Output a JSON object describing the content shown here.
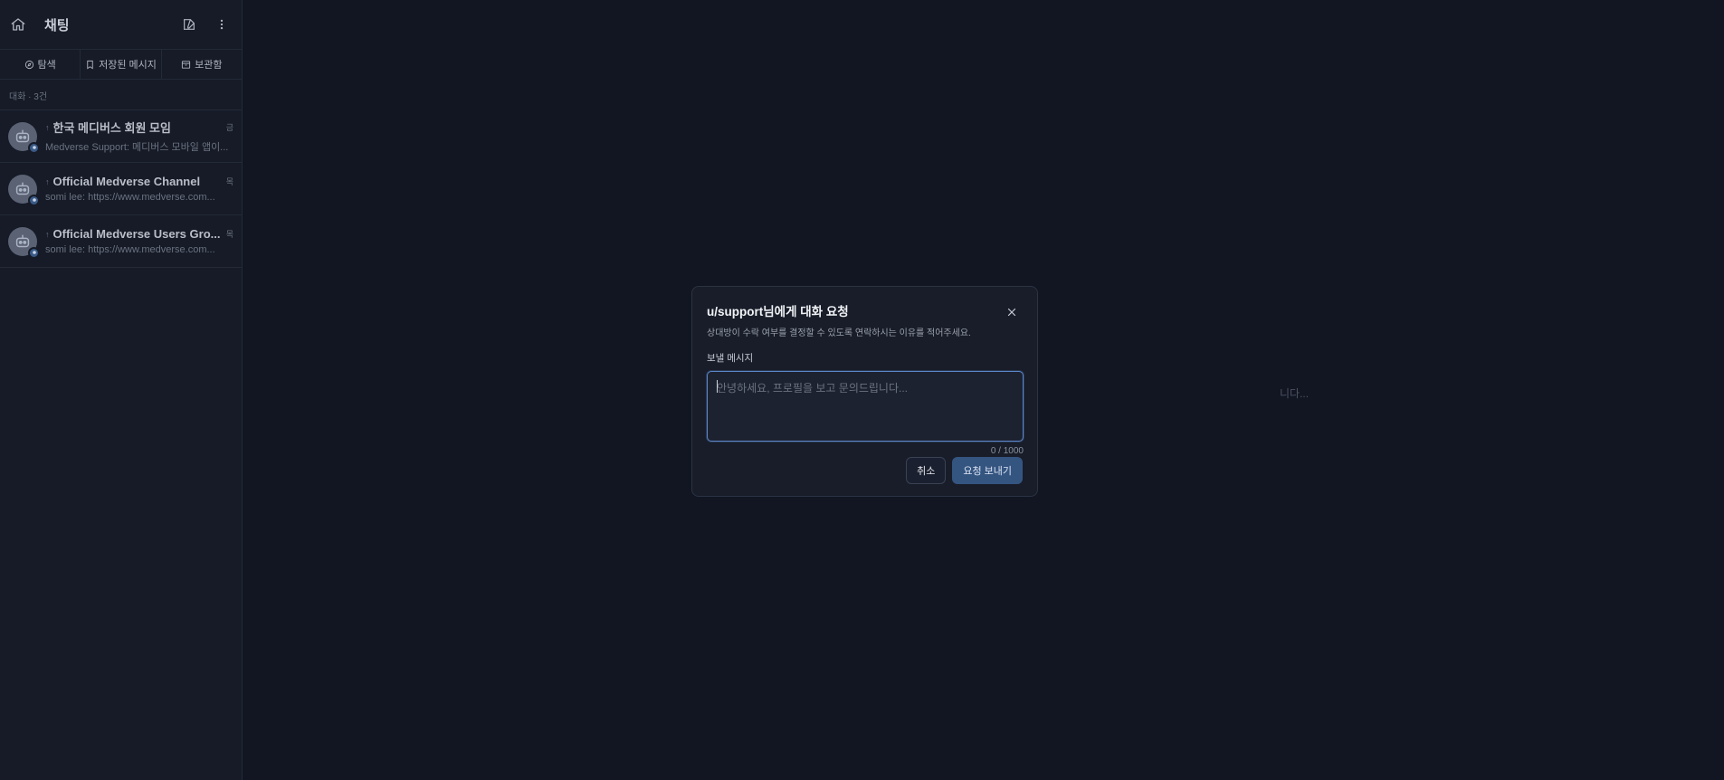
{
  "sidebar": {
    "title": "채팅",
    "tabs": [
      {
        "label": "탐색"
      },
      {
        "label": "저장된 메시지"
      },
      {
        "label": "보관함"
      }
    ],
    "count_label": "대화 · 3건",
    "conversations": [
      {
        "name": "한국 메디버스 회원 모임",
        "time": "금",
        "preview": "Medverse Support: 메디버스 모바일 앱이..."
      },
      {
        "name": "Official Medverse Channel",
        "time": "목",
        "preview": "somi lee: https://www.medverse.com..."
      },
      {
        "name": "Official Medverse Users Gro...",
        "time": "목",
        "preview": "somi lee: https://www.medverse.com..."
      }
    ]
  },
  "main": {
    "background_hint": "니다..."
  },
  "modal": {
    "title": "u/support님에게 대화 요청",
    "description": "상대방이 수락 여부를 결정할 수 있도록 연락하시는 이유를 적어주세요.",
    "field_label": "보낼 메시지",
    "placeholder": "안녕하세요, 프로필을 보고 문의드립니다...",
    "counter": "0 / 1000",
    "cancel_label": "취소",
    "send_label": "요청 보내기"
  },
  "colors": {
    "background": "#121622",
    "sidebar": "#161b27",
    "accent": "#355581",
    "focus_border": "#5b86c9"
  }
}
